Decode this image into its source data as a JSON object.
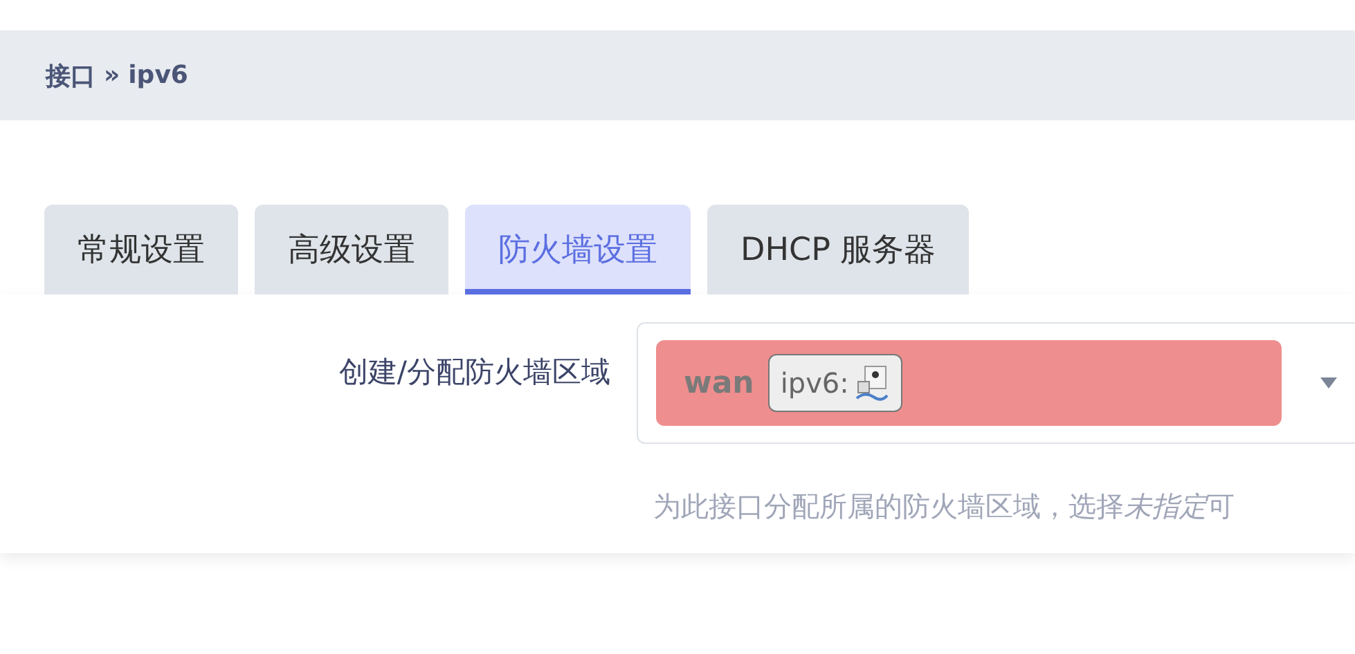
{
  "breadcrumb": {
    "parent": "接口",
    "separator": "»",
    "current": "ipv6"
  },
  "tabs": [
    {
      "label": "常规设置",
      "selected": false
    },
    {
      "label": "高级设置",
      "selected": false
    },
    {
      "label": "防火墙设置",
      "selected": true
    },
    {
      "label": "DHCP 服务器",
      "selected": false
    }
  ],
  "field": {
    "label": "创建/分配防火墙区域",
    "zone": {
      "name": "wan",
      "color": "#ef8e8e"
    },
    "network_tag": "ipv6:",
    "hint": {
      "before": "为此接口分配所属的防火墙区域，选择",
      "italic": "未指定",
      "after": "可"
    }
  }
}
